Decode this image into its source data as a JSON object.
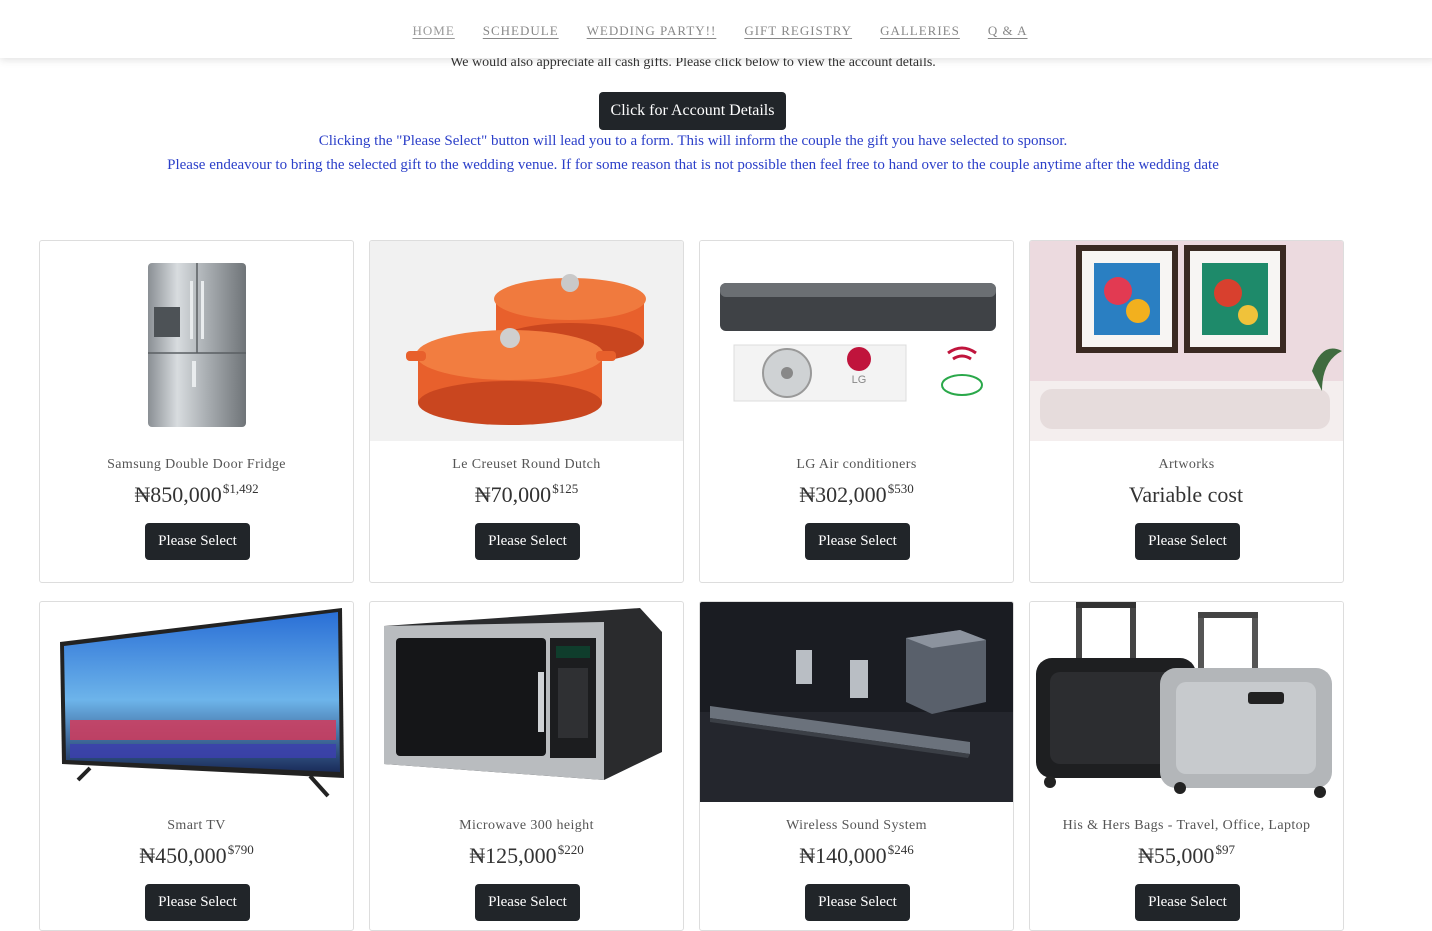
{
  "nav": {
    "items": [
      {
        "label": "HOME"
      },
      {
        "label": "SCHEDULE"
      },
      {
        "label": "WEDDING PARTY!!"
      },
      {
        "label": "GIFT REGISTRY"
      },
      {
        "label": "GALLERIES"
      },
      {
        "label": "Q & A"
      }
    ]
  },
  "intro": {
    "cash_note": "We would also appreciate all cash gifts. Please click below to view the account details.",
    "account_button": "Click for Account Details",
    "info_line1": "Clicking the \"Please Select\" button will lead you to a form. This will inform the couple the gift you have selected to sponsor.",
    "info_line2": "Please endeavour to bring the selected gift to the wedding venue. If for some reason that is not possible then feel free to hand over to the couple anytime after the wedding date"
  },
  "gifts": [
    {
      "name": "Samsung Double Door Fridge",
      "price": "₦850,000",
      "usd": "$1,492",
      "button": "Please Select",
      "image_icon": "fridge-image"
    },
    {
      "name": "Le Creuset Round Dutch",
      "price": "₦70,000",
      "usd": "$125",
      "button": "Please Select",
      "image_icon": "dutch-oven-image"
    },
    {
      "name": "LG Air conditioners",
      "price": "₦302,000",
      "usd": "$530",
      "button": "Please Select",
      "image_icon": "air-conditioner-image"
    },
    {
      "name": "Artworks",
      "price": "Variable cost",
      "usd": "",
      "button": "Please Select",
      "image_icon": "artwork-image"
    },
    {
      "name": "Smart TV",
      "price": "₦450,000",
      "usd": "$790",
      "button": "Please Select",
      "image_icon": "tv-image"
    },
    {
      "name": "Microwave 300 height",
      "price": "₦125,000",
      "usd": "$220",
      "button": "Please Select",
      "image_icon": "microwave-image"
    },
    {
      "name": "Wireless Sound System",
      "price": "₦140,000",
      "usd": "$246",
      "button": "Please Select",
      "image_icon": "sound-system-image"
    },
    {
      "name": "His & Hers Bags - Travel, Office, Laptop",
      "price": "₦55,000",
      "usd": "$97",
      "button": "Please Select",
      "image_icon": "luggage-image"
    }
  ],
  "colors": {
    "button_bg": "#212529",
    "info_text": "#2b3fc9",
    "pot_orange": "#e8602c"
  }
}
